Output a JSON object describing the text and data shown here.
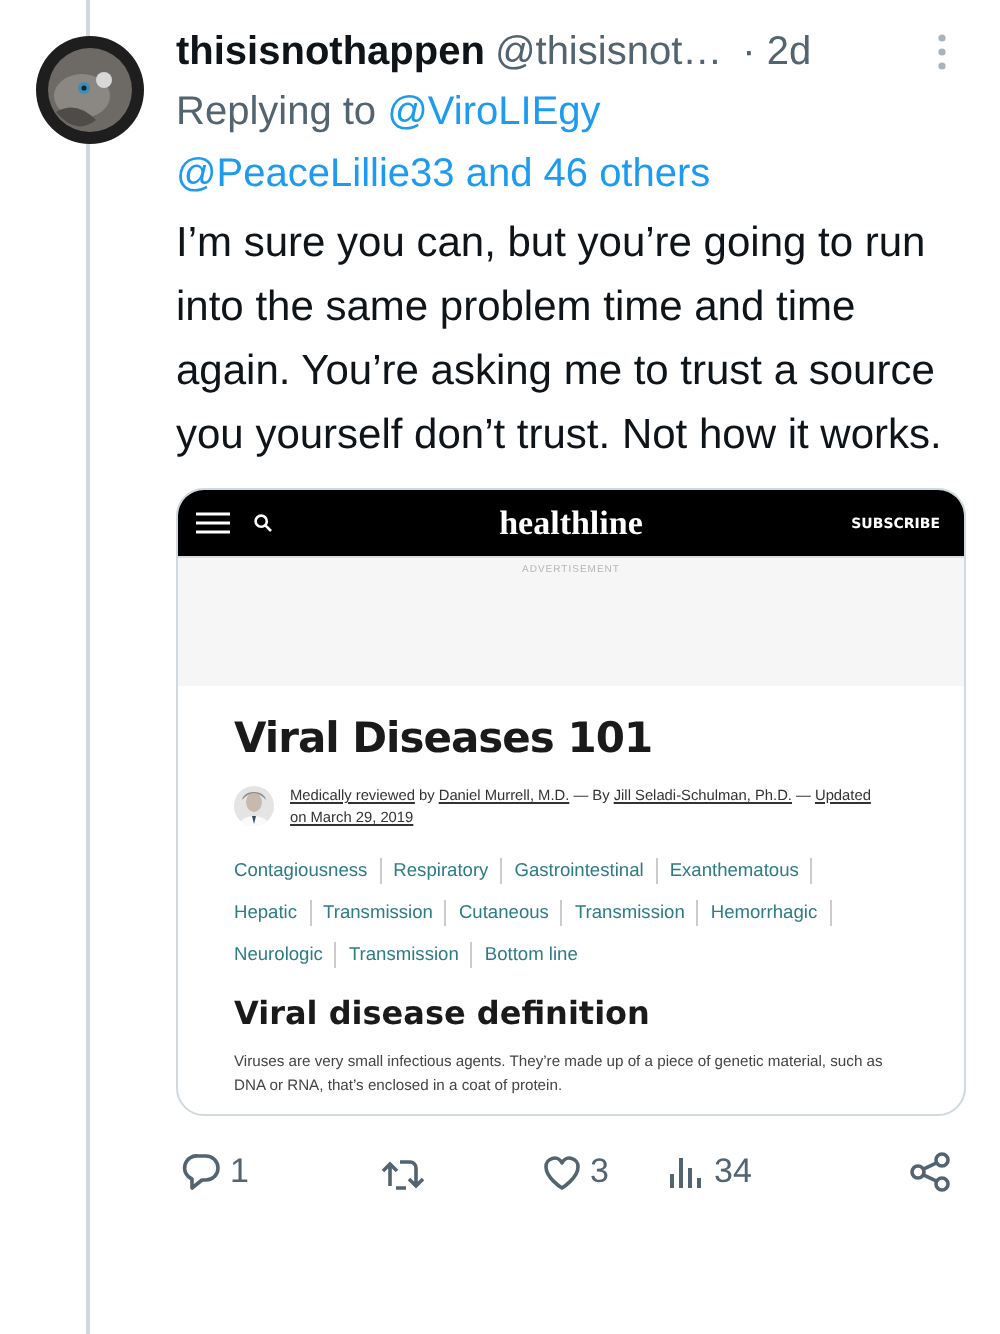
{
  "tweet": {
    "display_name": "thisisnothappen",
    "handle": "@thisisnot…",
    "time": "· 2d"
  },
  "reply_to": {
    "prefix": "Replying to",
    "mentions": [
      "@ViroLIEgy",
      "@PeaceLillie33 and 46 others"
    ]
  },
  "text": "I’m sure you can, but you’re going to run into the same problem time and time again. You’re asking me to trust a source you yourself don’t trust. Not how it works.",
  "embed": {
    "site_header": {
      "logo": "healthline",
      "subscribe": "SUBSCRIBE"
    },
    "ad_label": "ADVERTISEMENT",
    "title": "Viral Diseases 101",
    "byline": [
      {
        "kind": "link",
        "text": "Medically reviewed"
      },
      {
        "kind": "text",
        "text": " by "
      },
      {
        "kind": "link",
        "text": "Daniel Murrell, M.D."
      },
      {
        "kind": "text",
        "text": " — By "
      },
      {
        "kind": "link",
        "text": "Jill Seladi-Schulman, Ph.D."
      },
      {
        "kind": "text",
        "text": " — "
      },
      {
        "kind": "link",
        "text": "Updated"
      },
      {
        "kind": "link",
        "text": "on March 29, 2019"
      }
    ],
    "toc": [
      "Contagiousness",
      "Respiratory",
      "Gastrointestinal",
      "Exanthematous",
      "Hepatic",
      "Transmission",
      "Cutaneous",
      "Transmission",
      "Hemorrhagic",
      "Neurologic",
      "Transmission",
      "Bottom line"
    ],
    "section_title": "Viral disease definition",
    "paragraph": "Viruses are very small infectious agents. They’re made up of a piece of genetic material, such as DNA or RNA, that’s enclosed in a coat of protein."
  },
  "actions": [
    {
      "kind": "reply",
      "count": "1"
    },
    {
      "kind": "retweet"
    },
    {
      "kind": "like",
      "count": "3"
    },
    {
      "kind": "views",
      "count": "34"
    },
    {
      "kind": "share"
    }
  ]
}
